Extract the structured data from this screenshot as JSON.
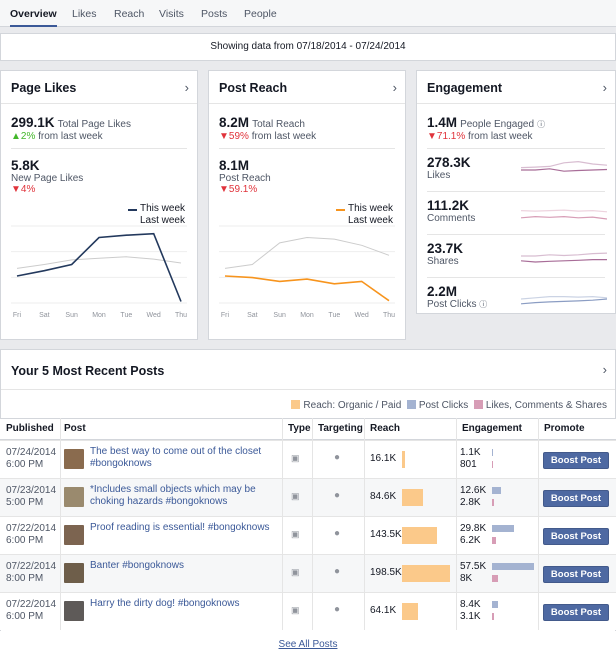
{
  "tabs": [
    "Overview",
    "Likes",
    "Reach",
    "Visits",
    "Posts",
    "People"
  ],
  "date_range": "Showing data from 07/18/2014 - 07/24/2014",
  "page_likes": {
    "title": "Page Likes",
    "total_value": "299.1K",
    "total_label": "Total Page Likes",
    "total_change": "2%",
    "total_change_label": "from last week",
    "new_value": "5.8K",
    "new_label": "New Page Likes",
    "new_change": "4%",
    "legend_this": "This week",
    "legend_last": "Last week",
    "days": [
      "Fri",
      "Sat",
      "Sun",
      "Mon",
      "Tue",
      "Wed",
      "Thu"
    ],
    "this_week": [
      0.35,
      0.42,
      0.5,
      0.85,
      0.88,
      0.9,
      0.02
    ],
    "last_week": [
      0.45,
      0.5,
      0.56,
      0.58,
      0.6,
      0.57,
      0.52
    ],
    "this_color": "#23395d",
    "last_color": "#cccccc"
  },
  "post_reach": {
    "title": "Post Reach",
    "total_value": "8.2M",
    "total_label": "Total Reach",
    "total_change": "59%",
    "total_change_label": "from last week",
    "post_value": "8.1M",
    "post_label": "Post Reach",
    "post_change": "59.1%",
    "legend_this": "This week",
    "legend_last": "Last week",
    "days": [
      "Fri",
      "Sat",
      "Sun",
      "Mon",
      "Tue",
      "Wed",
      "Thu"
    ],
    "this_week": [
      0.35,
      0.33,
      0.28,
      0.31,
      0.25,
      0.28,
      0.03
    ],
    "last_week": [
      0.45,
      0.5,
      0.78,
      0.85,
      0.83,
      0.75,
      0.62
    ],
    "this_color": "#f7941d",
    "last_color": "#cccccc"
  },
  "engagement": {
    "title": "Engagement",
    "people_value": "1.4M",
    "people_label": "People Engaged",
    "people_change": "71.1%",
    "people_change_label": "from last week",
    "items": [
      {
        "value": "278.3K",
        "label": "Likes",
        "color": "#a86d98",
        "a": [
          0.5,
          0.5,
          0.55,
          0.45,
          0.48,
          0.5,
          0.52
        ],
        "b": [
          0.6,
          0.62,
          0.65,
          0.8,
          0.85,
          0.75,
          0.7
        ]
      },
      {
        "value": "111.2K",
        "label": "Comments",
        "color": "#d79db6",
        "a": [
          0.3,
          0.35,
          0.32,
          0.35,
          0.3,
          0.33,
          0.25
        ],
        "b": [
          0.6,
          0.58,
          0.6,
          0.62,
          0.58,
          0.6,
          0.55
        ]
      },
      {
        "value": "23.7K",
        "label": "Shares",
        "color": "#a86d98",
        "a": [
          0.3,
          0.25,
          0.28,
          0.3,
          0.32,
          0.35,
          0.35
        ],
        "b": [
          0.5,
          0.5,
          0.55,
          0.52,
          0.55,
          0.6,
          0.62
        ]
      },
      {
        "value": "2.2M",
        "label": "Post Clicks",
        "color": "#8b9dc3",
        "a": [
          0.3,
          0.35,
          0.38,
          0.4,
          0.42,
          0.45,
          0.5
        ],
        "b": [
          0.5,
          0.55,
          0.6,
          0.6,
          0.58,
          0.6,
          0.55
        ]
      }
    ]
  },
  "recent": {
    "title": "Your 5 Most Recent Posts",
    "legend": [
      {
        "label": "Reach: Organic / Paid",
        "color": "#fbc98a"
      },
      {
        "label": "Post Clicks",
        "color": "#a4b3d1"
      },
      {
        "label": "Likes, Comments & Shares",
        "color": "#d79db6"
      }
    ],
    "columns": [
      "Published",
      "Post",
      "Type",
      "Targeting",
      "Reach",
      "Engagement",
      "Promote"
    ],
    "rows": [
      {
        "date": "07/24/2014",
        "time": "6:00 PM",
        "post": "The best way to come out of the closet #bongoknows",
        "reach": "16.1K",
        "reach_frac": 0.02,
        "clicks": "1.1K",
        "lcs": "801",
        "clicks_frac": 0.01,
        "lcs_frac": 0.0,
        "thumb": "#8a6b4e"
      },
      {
        "date": "07/23/2014",
        "time": "5:00 PM",
        "post": "*Includes small objects which may be choking hazards #bongoknows",
        "reach": "84.6K",
        "reach_frac": 0.43,
        "clicks": "12.6K",
        "lcs": "2.8K",
        "clicks_frac": 0.21,
        "lcs_frac": 0.05,
        "thumb": "#9a8a6e"
      },
      {
        "date": "07/22/2014",
        "time": "6:00 PM",
        "post": "Proof reading is essential! #bongoknows",
        "reach": "143.5K",
        "reach_frac": 0.73,
        "clicks": "29.8K",
        "lcs": "6.2K",
        "clicks_frac": 0.52,
        "lcs_frac": 0.1,
        "thumb": "#7c6450"
      },
      {
        "date": "07/22/2014",
        "time": "8:00 PM",
        "post": "Banter #bongoknows",
        "reach": "198.5K",
        "reach_frac": 1.0,
        "clicks": "57.5K",
        "lcs": "8K",
        "clicks_frac": 1.0,
        "lcs_frac": 0.14,
        "thumb": "#6e5e4a"
      },
      {
        "date": "07/22/2014",
        "time": "6:00 PM",
        "post": "Harry the dirty dog! #bongoknows",
        "reach": "64.1K",
        "reach_frac": 0.33,
        "clicks": "8.4K",
        "lcs": "3.1K",
        "clicks_frac": 0.15,
        "lcs_frac": 0.05,
        "thumb": "#5e5a58"
      }
    ],
    "boost_label": "Boost Post",
    "see_all": "See All Posts"
  }
}
